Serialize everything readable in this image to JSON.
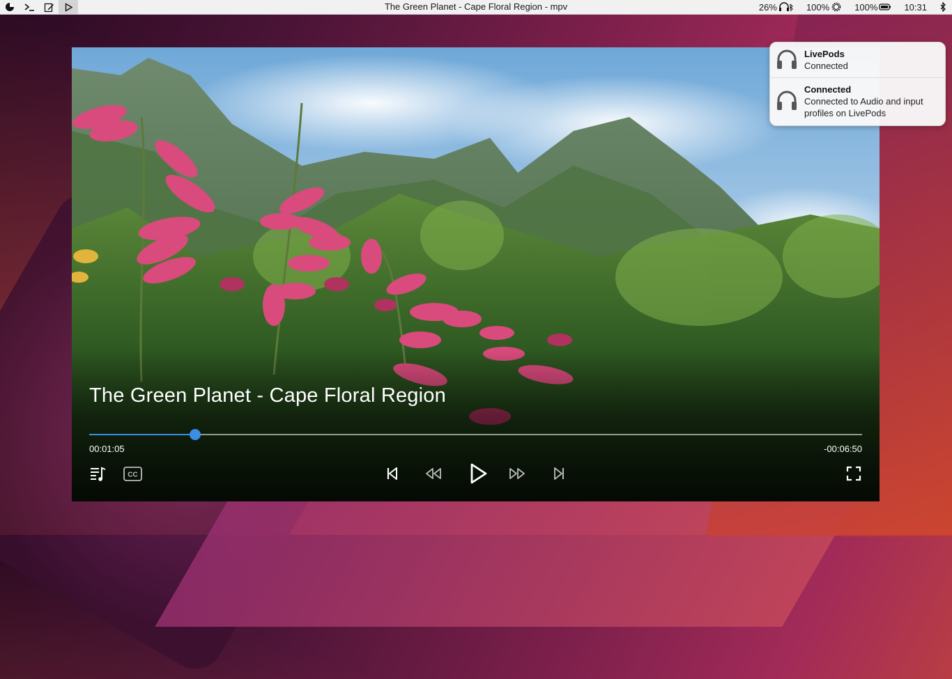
{
  "topbar": {
    "window_title": "The Green Planet - Cape Floral Region - mpv",
    "status": {
      "headphones_battery": "26%",
      "volume": "100%",
      "battery": "100%",
      "clock": "10:31"
    },
    "icons": [
      "app-menu-icon",
      "terminal-icon",
      "edit-icon",
      "play-icon",
      "headphones-icon",
      "brightness-icon",
      "battery-icon",
      "bluetooth-icon"
    ]
  },
  "player": {
    "title": "The Green Planet - Cape Floral Region",
    "elapsed": "00:01:05",
    "remaining": "-00:06:50",
    "progress_fraction": 0.1369,
    "accent_color": "#3a8ee6",
    "controls": [
      "playlist-icon",
      "subtitles-icon",
      "skip-previous-icon",
      "rewind-icon",
      "play-icon",
      "fast-forward-icon",
      "skip-next-icon",
      "fullscreen-icon"
    ]
  },
  "notifications": [
    {
      "title": "LivePods",
      "body": "Connected",
      "icon": "headphones-icon"
    },
    {
      "title": "Connected",
      "body": "Connected to Audio and input profiles on LivePods",
      "icon": "headphones-icon"
    }
  ]
}
